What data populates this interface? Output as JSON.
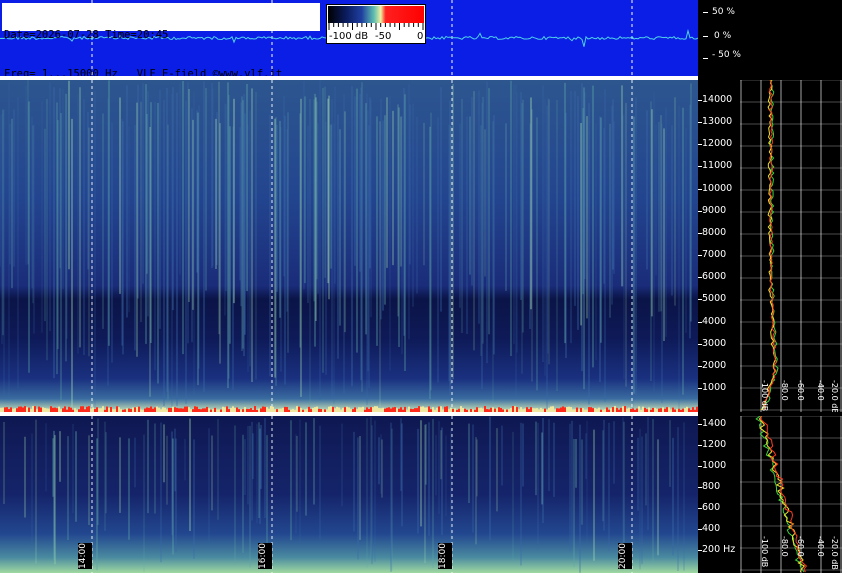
{
  "header": {
    "line1": "Date=2026-07-28 Time=20:45",
    "line2": "Freq= 1...15000 Hz   VLF E-field ©www.vlf.it"
  },
  "colorbar": {
    "label_left": "-100 dB",
    "label_mid": "-50",
    "label_right": "0"
  },
  "waveform_scale": [
    "50 %",
    "0 %",
    "- 50 %"
  ],
  "upper_freq_ticks": [
    "14000",
    "13000",
    "12000",
    "11000",
    "10000",
    "9000",
    "8000",
    "7000",
    "6000",
    "5000",
    "4000",
    "3000",
    "2000",
    "1000"
  ],
  "lower_freq_ticks": [
    "1400",
    "1200",
    "1000",
    "800",
    "600",
    "400",
    "200 Hz"
  ],
  "time_labels": [
    "14:00",
    "16:00",
    "18:00",
    "20:00"
  ],
  "spectrum_db_labels": [
    "-100 dB",
    "-80.0",
    "-60.0",
    "-40.0",
    "-20.0 dB"
  ],
  "colors": {
    "waveform_bg": "#0a1ee6",
    "waveform_trace": "#4fd2e8",
    "spectrogram_dark": "#0b1447",
    "spectrogram_mid": "#23428f",
    "spectrogram_bright": "#6fc28a",
    "energy": "#ff2a1a",
    "trace_green": "#3cd23c",
    "trace_yellow": "#f0e030",
    "trace_red": "#ff3a20"
  }
}
